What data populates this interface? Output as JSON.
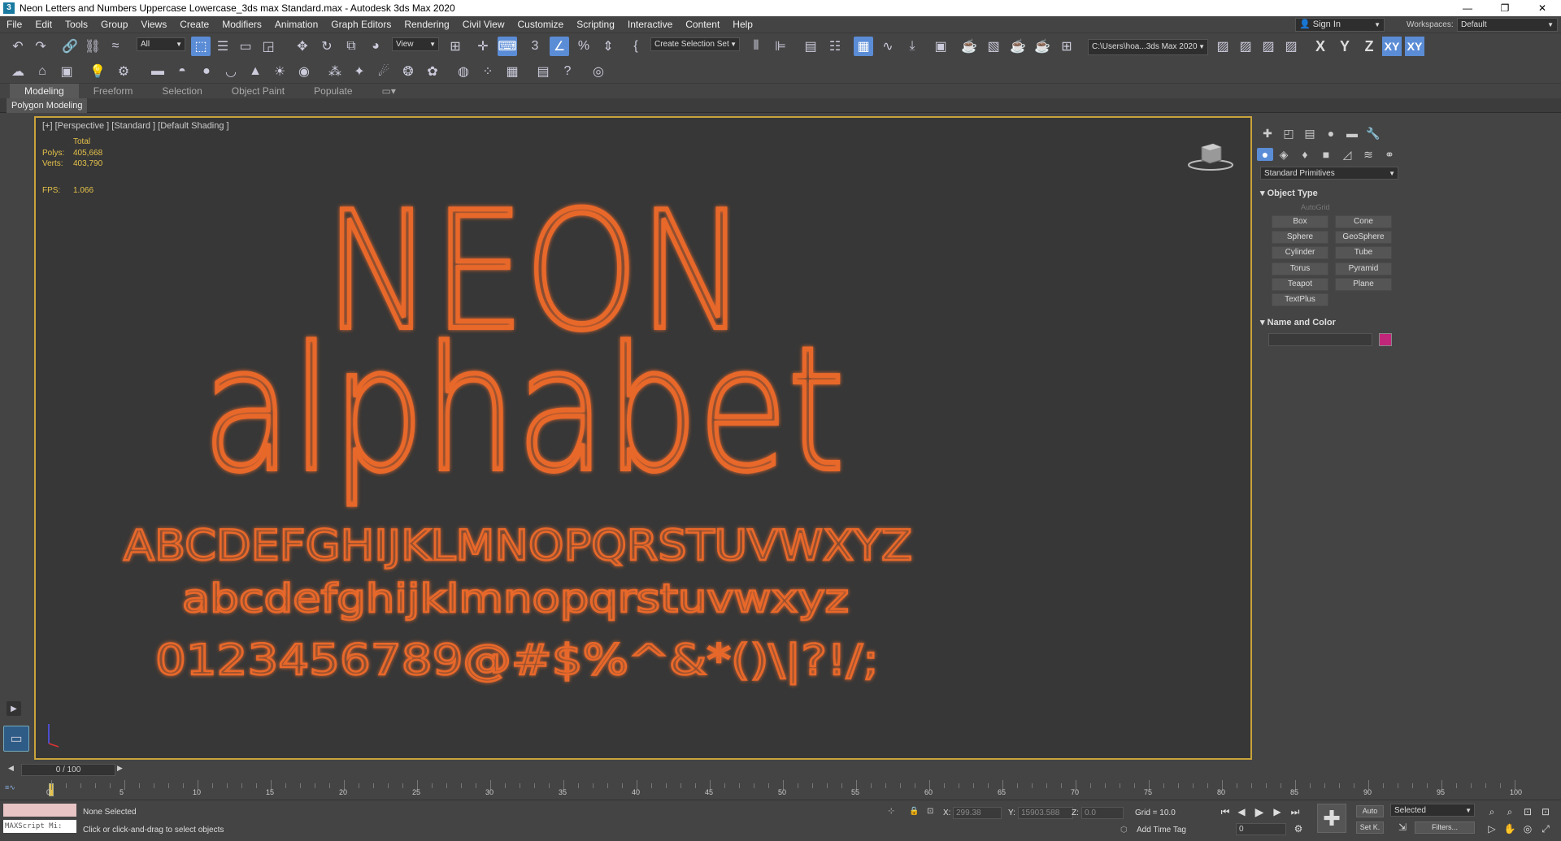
{
  "window": {
    "title": "Neon Letters and Numbers Uppercase Lowercase_3ds max Standard.max - Autodesk 3ds Max 2020",
    "app_icon": "3",
    "controls": [
      "—",
      "❐",
      "✕"
    ]
  },
  "menu": [
    "File",
    "Edit",
    "Tools",
    "Group",
    "Views",
    "Create",
    "Modifiers",
    "Animation",
    "Graph Editors",
    "Rendering",
    "Civil View",
    "Customize",
    "Scripting",
    "Interactive",
    "Content",
    "Help"
  ],
  "account": {
    "sign_in": "Sign In",
    "workspaces_label": "Workspaces:",
    "workspace": "Default"
  },
  "toolbar": {
    "selection_filter": "All",
    "reference_coord": "View",
    "named_selection": "Create Selection Set",
    "project_path": "C:\\Users\\hoa...3ds Max 2020",
    "axes": [
      "X",
      "Y",
      "Z",
      "XY",
      "XY"
    ]
  },
  "ribbon": {
    "tabs": [
      "Modeling",
      "Freeform",
      "Selection",
      "Object Paint",
      "Populate"
    ],
    "sub": "Polygon Modeling"
  },
  "viewport": {
    "label": "[+] [Perspective ] [Standard ] [Default Shading ]",
    "stats": {
      "total_label": "Total",
      "polys_label": "Polys:",
      "polys": "405,668",
      "verts_label": "Verts:",
      "verts": "403,790",
      "fps_label": "FPS:",
      "fps": "1.066"
    },
    "scene_text": {
      "line1": "NEON",
      "line2": "alphabet",
      "line3": "ABCDEFGHIJKLMNOPQRSTUVWXYZ",
      "line4": "abcdefghijklmnopqrstuvwxyz",
      "line5": "0123456789@#$%^&*()\\|?!/;"
    },
    "neon_color": "#e8682a"
  },
  "command_panel": {
    "category": "Standard Primitives",
    "object_type_title": "Object Type",
    "autogrid": "AutoGrid",
    "buttons": [
      "Box",
      "Cone",
      "Sphere",
      "GeoSphere",
      "Cylinder",
      "Tube",
      "Torus",
      "Pyramid",
      "Teapot",
      "Plane",
      "TextPlus"
    ],
    "name_color_title": "Name and Color",
    "swatch_color": "#c2267a"
  },
  "timeline": {
    "slider": "0 / 100",
    "ticks": [
      "0",
      "5",
      "10",
      "15",
      "20",
      "25",
      "30",
      "35",
      "40",
      "45",
      "50",
      "55",
      "60",
      "65",
      "70",
      "75",
      "80",
      "85",
      "90",
      "95",
      "100"
    ]
  },
  "status": {
    "maxscript": "MAXScript Mi:",
    "selection": "None Selected",
    "prompt": "Click or click-and-drag to select objects",
    "x_label": "X:",
    "x": "299.38",
    "y_label": "Y:",
    "y": "15903.588",
    "z_label": "Z:",
    "z": "0.0",
    "grid": "Grid = 10.0",
    "add_time_tag": "Add Time Tag",
    "auto": "Auto",
    "set_key": "Set K.",
    "key_filter": "Selected",
    "filters": "Filters...",
    "frame": "0"
  }
}
